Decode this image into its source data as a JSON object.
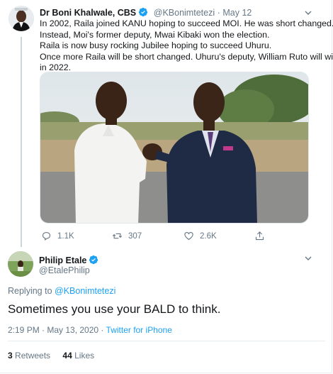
{
  "parent_tweet": {
    "author_name": "Dr Boni Khalwale, CBS",
    "author_handle": "@KBonimtetezi",
    "date": "May 12",
    "lines": [
      "In 2002, Raila joined KANU hoping to succeed MOI. He was short changed.",
      "Instead, Moi's former deputy, Mwai Kibaki won the election.",
      "Raila is now busy rocking Jubilee hoping to succeed Uhuru.",
      "Once more Raila will be short changed. Uhuru's deputy, William Ruto will win",
      "in 2022."
    ],
    "replies": "1.1K",
    "retweets": "307",
    "likes": "2.6K"
  },
  "main_tweet": {
    "author_name": "Philip Etale",
    "author_handle": "@EtalePhilip",
    "replying_prefix": "Replying to",
    "replying_handle": "@KBonimtetezi",
    "text": "Sometimes you use your BALD to think.",
    "time": "2:19 PM · May 13, 2020 ·",
    "source": "Twitter for iPhone",
    "retweet_count": "3",
    "retweet_label": "Retweets",
    "like_count": "44",
    "like_label": "Likes"
  },
  "colors": {
    "link": "#1da1f2",
    "muted": "#657786",
    "verified": "#1da1f2",
    "divider": "#e6ecf0"
  }
}
